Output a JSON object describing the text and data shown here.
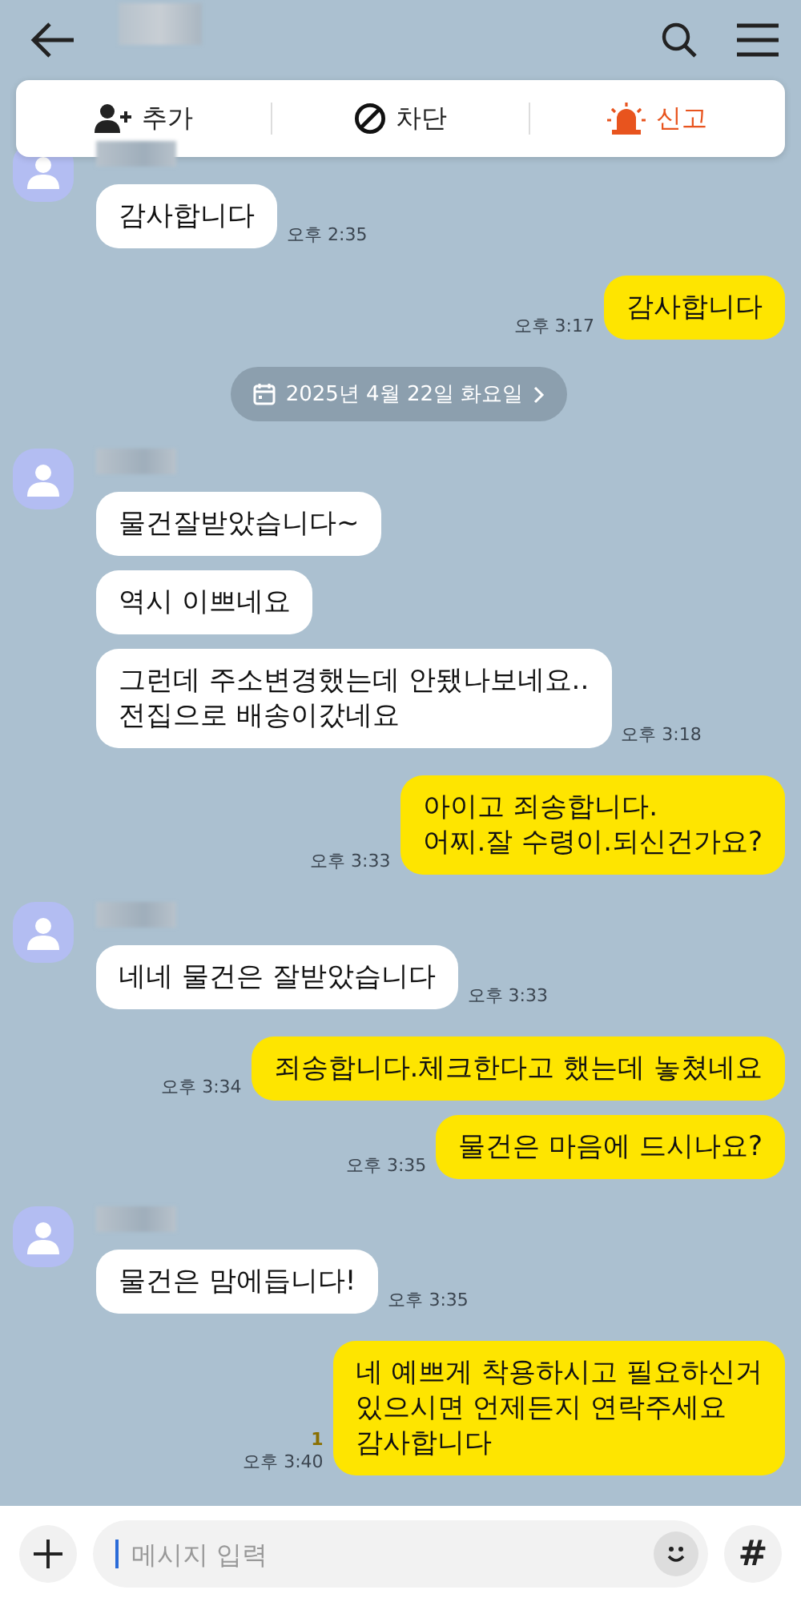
{
  "actions": [
    {
      "kind": "add",
      "label": "추가"
    },
    {
      "kind": "block",
      "label": "차단"
    },
    {
      "kind": "report",
      "label": "신고"
    }
  ],
  "chat": [
    {
      "kind": "received",
      "bubbles": [
        "감사합니다"
      ],
      "time": "오후 2:35"
    },
    {
      "kind": "sent",
      "text": "감사합니다",
      "time": "오후 3:17"
    },
    {
      "kind": "date",
      "text": "2025년 4월 22일 화요일"
    },
    {
      "kind": "received",
      "bubbles": [
        "물건잘받았습니다~",
        "역시 이쁘네요",
        "그런데 주소변경했는데 안됐나보네요..\n전집으로 배송이갔네요"
      ],
      "time": "오후 3:18"
    },
    {
      "kind": "sent",
      "text": "아이고 죄송합니다.\n어찌.잘 수령이.되신건가요?",
      "time": "오후 3:33"
    },
    {
      "kind": "received",
      "bubbles": [
        "네네 물건은 잘받았습니다"
      ],
      "time": "오후 3:33"
    },
    {
      "kind": "sent",
      "text": "죄송합니다.체크한다고 했는데 놓쳤네요",
      "time": "오후 3:34"
    },
    {
      "kind": "sent",
      "text": "물건은 마음에 드시나요?",
      "time": "오후 3:35"
    },
    {
      "kind": "received",
      "bubbles": [
        "물건은 맘에듭니다!"
      ],
      "time": "오후 3:35"
    },
    {
      "kind": "sent",
      "text": "네 예쁘게 착용하시고 필요하신거\n있으시면 언제든지 연락주세요\n감사합니다",
      "time": "오후 3:40",
      "unread": "1"
    }
  ],
  "composer": {
    "placeholder": "메시지 입력",
    "hash": "#"
  }
}
